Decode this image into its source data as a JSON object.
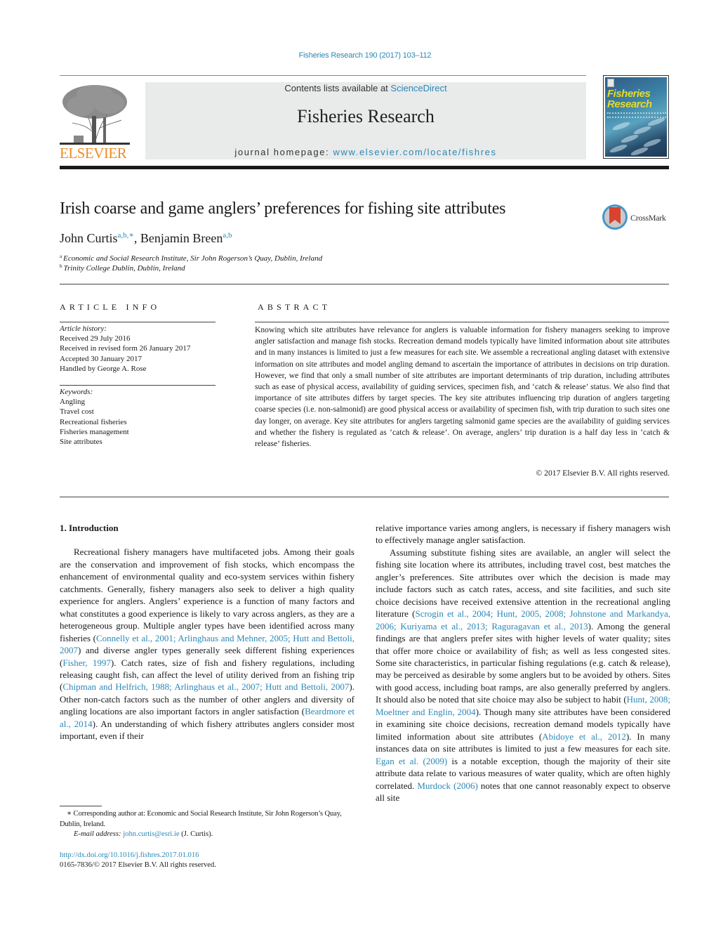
{
  "header": {
    "journal_ref": "Fisheries Research 190 (2017) 103–112",
    "contents_prefix": "Contents lists available at ",
    "contents_link": "ScienceDirect",
    "journal_title": "Fisheries Research",
    "homepage_prefix": "journal homepage: ",
    "homepage_link": "www.elsevier.com/locate/fishres",
    "publisher_wordmark": "ELSEVIER",
    "cover_title_line1": "Fisheries",
    "cover_title_line2": "Research",
    "crossmark_label": "CrossMark"
  },
  "colors": {
    "link": "#2a88b7",
    "elsevier_orange": "#f08c24",
    "masthead_bg": "#e9eaea",
    "crossmark_red": "#d9432e",
    "cover_title": "#e8d92a"
  },
  "article": {
    "title": "Irish coarse and game anglers’ preferences for fishing site attributes",
    "authors": [
      {
        "name": "John Curtis",
        "sup": "a,b,∗"
      },
      {
        "name": "Benjamin Breen",
        "sup": "a,b"
      }
    ],
    "author_separator": ", ",
    "affiliations": [
      {
        "key": "a",
        "text": "Economic and Social Research Institute, Sir John Rogerson’s Quay, Dublin, Ireland"
      },
      {
        "key": "b",
        "text": "Trinity College Dublin, Dublin, Ireland"
      }
    ]
  },
  "article_info": {
    "heading": "ARTICLE INFO",
    "history_label": "Article history:",
    "history": [
      "Received 29 July 2016",
      "Received in revised form 26 January 2017",
      "Accepted 30 January 2017",
      "Handled by George A. Rose"
    ],
    "keywords_label": "Keywords:",
    "keywords": [
      "Angling",
      "Travel cost",
      "Recreational fisheries",
      "Fisheries management",
      "Site attributes"
    ]
  },
  "abstract": {
    "heading": "ABSTRACT",
    "text": "Knowing which site attributes have relevance for anglers is valuable information for fishery managers seeking to improve angler satisfaction and manage fish stocks. Recreation demand models typically have limited information about site attributes and in many instances is limited to just a few measures for each site. We assemble a recreational angling dataset with extensive information on site attributes and model angling demand to ascertain the importance of attributes in decisions on trip duration. However, we find that only a small number of site attributes are important determinants of trip duration, including attributes such as ease of physical access, availability of guiding services, specimen fish, and ‘catch & release’ status. We also find that importance of site attributes differs by target species. The key site attributes influencing trip duration of anglers targeting coarse species (i.e. non-salmonid) are good physical access or availability of specimen fish, with trip duration to such sites one day longer, on average. Key site attributes for anglers targeting salmonid game species are the availability of guiding services and whether the fishery is regulated as ‘catch & release’. On average, anglers’ trip duration is a half day less in ‘catch & release’ fisheries.",
    "copyright": "© 2017 Elsevier B.V. All rights reserved."
  },
  "body": {
    "section_heading": "1.  Introduction",
    "left": {
      "p1": [
        {
          "t": "Recreational fishery managers have multifaceted jobs. Among their goals are the conservation and improvement of fish stocks, which encompass the enhancement of environmental quality and eco-system services within fishery catchments. Generally, fishery managers also seek to deliver a high quality experience for anglers. Anglers’ experience is a function of many factors and what constitutes a good experience is likely to vary across anglers, as they are a heterogeneous group. Multiple angler types have been identified across many fisheries ("
        },
        {
          "t": "Connelly et al., 2001; Arlinghaus and Mehner, 2005; Hutt and Bettoli, 2007",
          "link": true
        },
        {
          "t": ") and diverse angler types generally seek different fishing experiences ("
        },
        {
          "t": "Fisher, 1997",
          "link": true
        },
        {
          "t": "). Catch rates, size of fish and fishery regulations, including releasing caught fish, can affect the level of utility derived from an fishing trip ("
        },
        {
          "t": "Chipman and Helfrich, 1988; Arlinghaus et al., 2007; Hutt and Bettoli, 2007",
          "link": true
        },
        {
          "t": "). Other non-catch factors such as the number of other anglers and diversity of angling locations are also important factors in angler satisfaction ("
        },
        {
          "t": "Beardmore et al., 2014",
          "link": true
        },
        {
          "t": "). An understanding of which fishery attributes anglers consider most important, even if their"
        }
      ]
    },
    "right": {
      "p0": [
        {
          "t": "relative importance varies among anglers, is necessary if fishery managers wish to effectively manage angler satisfaction."
        }
      ],
      "p1": [
        {
          "t": "Assuming substitute fishing sites are available, an angler will select the fishing site location where its attributes, including travel cost, best matches the angler’s preferences. Site attributes over which the decision is made may include factors such as catch rates, access, and site facilities, and such site choice decisions have received extensive attention in the recreational angling literature ("
        },
        {
          "t": "Scrogin et al., 2004; Hunt, 2005, 2008; Johnstone and Markandya, 2006; Kuriyama et al., 2013; Raguragavan et al., 2013",
          "link": true
        },
        {
          "t": "). Among the general findings are that anglers prefer sites with higher levels of water quality; sites that offer more choice or availability of fish; as well as less congested sites. Some site characteristics, in particular fishing regulations (e.g. catch & release), may be perceived as desirable by some anglers but to be avoided by others. Sites with good access, including boat ramps, are also generally preferred by anglers. It should also be noted that site choice may also be subject to habit ("
        },
        {
          "t": "Hunt, 2008; Moeltner and Englin, 2004",
          "link": true
        },
        {
          "t": "). Though many site attributes have been considered in examining site choice decisions, recreation demand models typically have limited information about site attributes ("
        },
        {
          "t": "Abidoye et al., 2012",
          "link": true
        },
        {
          "t": "). In many instances data on site attributes is limited to just a few measures for each site. "
        },
        {
          "t": "Egan et al. (2009)",
          "link": true
        },
        {
          "t": " is a notable exception, though the majority of their site attribute data relate to various measures of water quality, which are often highly correlated. "
        },
        {
          "t": "Murdock (2006)",
          "link": true
        },
        {
          "t": " notes that one cannot reasonably expect to observe all site"
        }
      ]
    }
  },
  "footnotes": {
    "corresponding": "∗  Corresponding author at: Economic and Social Research Institute, Sir John Rogerson’s Quay, Dublin, Ireland.",
    "email_label": "E-mail address: ",
    "email": "john.curtis@esri.ie",
    "email_suffix": " (J. Curtis).",
    "doi": "http://dx.doi.org/10.1016/j.fishres.2017.01.016",
    "issn": "0165-7836/© 2017 Elsevier B.V. All rights reserved."
  }
}
